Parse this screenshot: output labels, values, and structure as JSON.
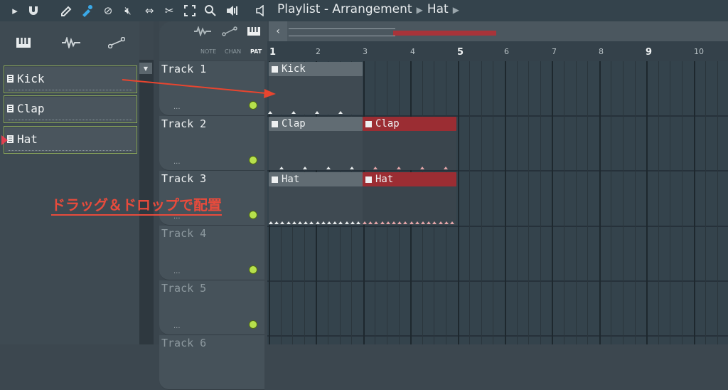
{
  "toolbar": {
    "icons": [
      "play-arrow-icon",
      "magnet-icon",
      "pencil-icon",
      "brush-icon",
      "delete-icon",
      "mute-icon",
      "slip-icon",
      "slice-icon",
      "select-icon",
      "zoom-icon",
      "playback-icon",
      "speaker-icon"
    ],
    "breadcrumb": {
      "part1": "Playlist - Arrangement",
      "part2": "Hat"
    }
  },
  "browser": {
    "tabs": [
      "piano-icon",
      "waveform-icon",
      "automation-icon"
    ],
    "patterns": [
      {
        "label": "Kick"
      },
      {
        "label": "Clap"
      },
      {
        "label": "Hat"
      }
    ]
  },
  "header": {
    "mode_labels": {
      "note": "NOTE",
      "chan": "CHAN",
      "pat": "PAT"
    }
  },
  "tracks": [
    {
      "name": "Track 1",
      "dots": "..."
    },
    {
      "name": "Track 2",
      "dots": "..."
    },
    {
      "name": "Track 3",
      "dots": "..."
    },
    {
      "name": "Track 4",
      "dots": "..."
    },
    {
      "name": "Track 5",
      "dots": "..."
    },
    {
      "name": "Track 6",
      "dots": ""
    }
  ],
  "ruler": {
    "numbers": [
      "1",
      "2",
      "3",
      "4",
      "5",
      "6",
      "7",
      "8",
      "9",
      "10"
    ]
  },
  "clips": [
    {
      "label": "Kick",
      "track": 1,
      "color": "grey"
    },
    {
      "label": "Clap",
      "track": 2,
      "color": "grey"
    },
    {
      "label": "Clap",
      "track": 2,
      "color": "red"
    },
    {
      "label": "Hat",
      "track": 3,
      "color": "grey"
    },
    {
      "label": "Hat",
      "track": 3,
      "color": "red"
    }
  ],
  "annotation": {
    "text": "ドラッグ＆ドロップで配置",
    "color": "#e84b3c"
  },
  "colors": {
    "accent_red": "#9b2d33",
    "led_green": "#b7e04c",
    "pattern_border": "#8ca85a"
  }
}
